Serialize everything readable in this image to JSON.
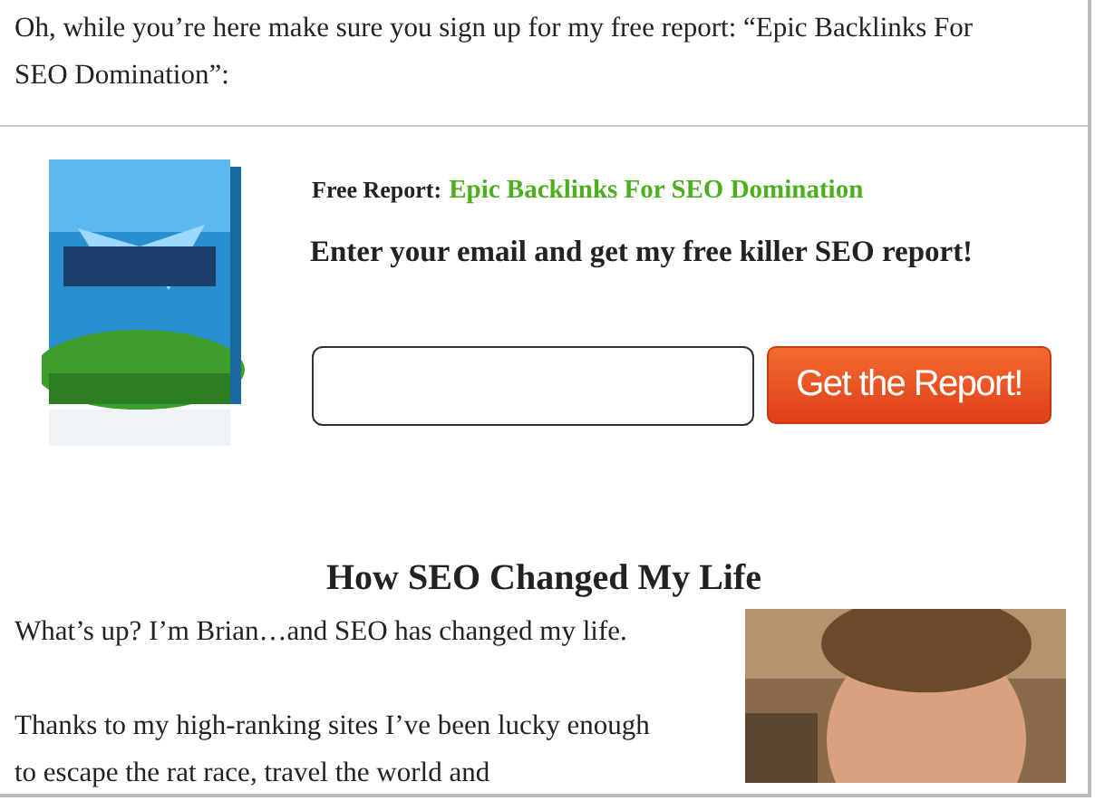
{
  "intro": "Oh, while you’re here make sure you sign up for my free report: “Epic Backlinks For SEO Domination”:",
  "optin": {
    "label": "Free Report:",
    "report_link": "Epic Backlinks For SEO Domination",
    "headline": "Enter your email and get my free killer SEO report!",
    "button": "Get the Report!"
  },
  "section": {
    "heading": "How SEO Changed My Life",
    "paragraphs": [
      "What’s up? I’m Brian…and SEO has changed my life.",
      "Thanks to my high-ranking sites I’ve been lucky enough to escape the rat race, travel the world and"
    ]
  }
}
